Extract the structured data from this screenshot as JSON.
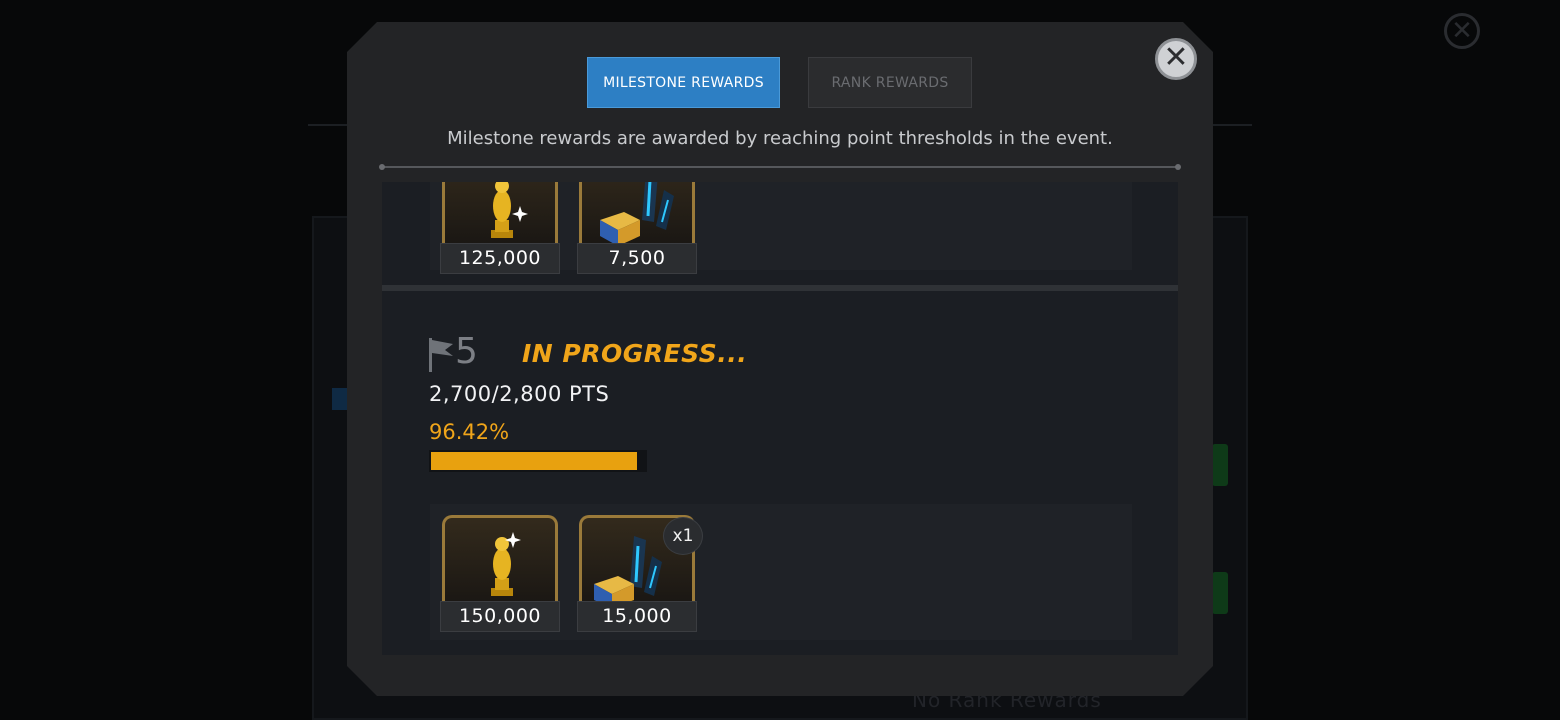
{
  "background": {
    "close_symbol": "✕",
    "faint_texts": [
      "No Rank Rewards"
    ]
  },
  "modal": {
    "close_symbol": "✕",
    "tabs": [
      {
        "label": "MILESTONE REWARDS",
        "active": true
      },
      {
        "label": "RANK REWARDS",
        "active": false
      }
    ],
    "description": "Milestone rewards are awarded by reaching point thresholds in the event."
  },
  "milestones": {
    "previous": {
      "rewards": [
        {
          "icon": "gold-trophy-icon",
          "value": "125,000"
        },
        {
          "icon": "crystal-shard-icon",
          "value": "7,500"
        }
      ]
    },
    "current": {
      "number": "5",
      "status": "IN PROGRESS...",
      "points": "2,700/2,800 PTS",
      "percent_text": "96.42%",
      "progress_fraction": 0.9642,
      "rewards": [
        {
          "icon": "gold-trophy-icon",
          "value": "150,000"
        },
        {
          "icon": "crystal-shard-icon",
          "value": "15,000",
          "quantity": "x1"
        }
      ]
    }
  },
  "colors": {
    "accent_blue": "#2d7fc4",
    "progress_gold": "#e8a10f",
    "status_orange": "#f0a51a"
  }
}
